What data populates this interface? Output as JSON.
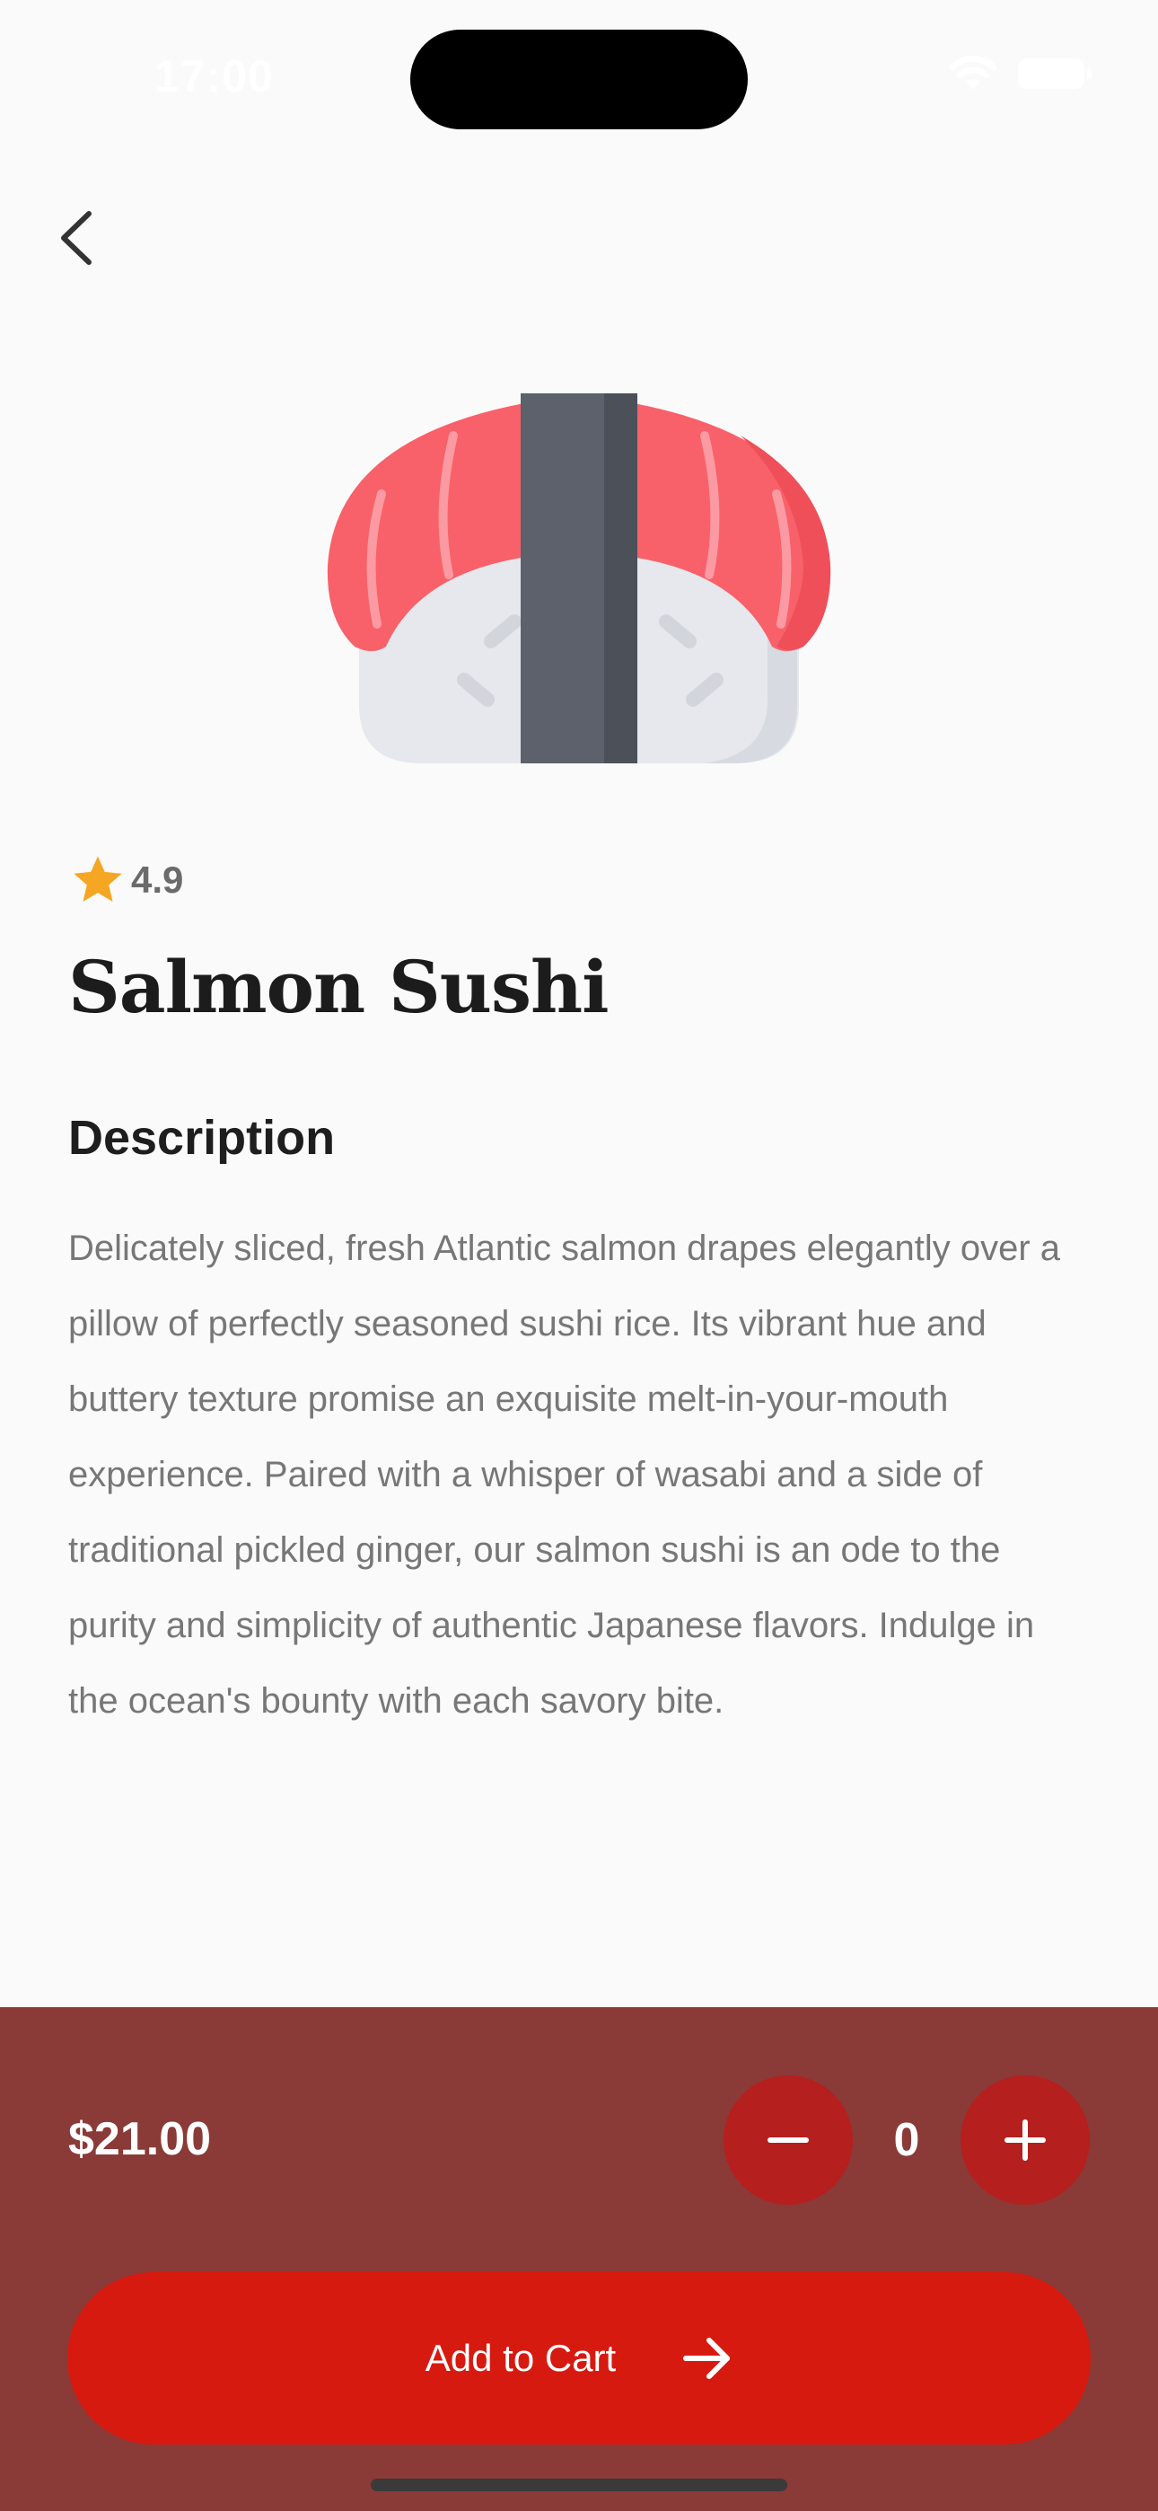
{
  "status_bar": {
    "time": "17:00",
    "icons": [
      "wifi-icon",
      "battery-icon"
    ]
  },
  "nav": {
    "back_icon": "chevron-left-icon"
  },
  "product": {
    "image_icon": "salmon-sushi-icon",
    "rating": "4.9",
    "rating_icon": "star-icon",
    "name": "Salmon Sushi",
    "description_heading": "Description",
    "description": "Delicately sliced, fresh Atlantic salmon drapes elegantly over a pillow of perfectly seasoned sushi rice. Its vibrant hue and buttery texture promise an exquisite melt-in-your-mouth experience. Paired with a whisper of wasabi and a side of traditional pickled ginger, our salmon sushi is an ode to the purity and simplicity of authentic Japanese flavors. Indulge in the ocean's bounty with each savory bite."
  },
  "checkout": {
    "price": "$21.00",
    "quantity": "0",
    "add_to_cart_label": "Add to Cart",
    "arrow_icon": "arrow-right-icon"
  },
  "colors": {
    "background": "#fafafa",
    "panel": "#8a3a37",
    "primary_button": "#d71a10",
    "qty_button": "#b51f1e",
    "star": "#f5a623"
  }
}
